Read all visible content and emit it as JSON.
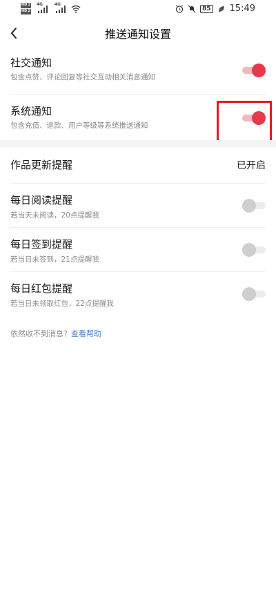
{
  "status_bar": {
    "time": "15:49",
    "battery": "85",
    "network_1": "4G",
    "network_2": "4G",
    "hd_label": "HD"
  },
  "header": {
    "title": "推送通知设置"
  },
  "sections": {
    "social": {
      "title": "社交通知",
      "desc": "包含点赞、评论回复等社交互动相关消息通知",
      "enabled": true
    },
    "system": {
      "title": "系统通知",
      "desc": "包含充值、退款、用户等级等系统推送通知",
      "enabled": true
    },
    "works_update": {
      "title": "作品更新提醒",
      "status": "已开启"
    },
    "daily_read": {
      "title": "每日阅读提醒",
      "desc": "若当天未阅读，20点提醒我",
      "enabled": false
    },
    "daily_checkin": {
      "title": "每日签到提醒",
      "desc": "若当日未签到，21点提醒我",
      "enabled": false
    },
    "daily_redpacket": {
      "title": "每日红包提醒",
      "desc": "若当日未领取红包，22点提醒我",
      "enabled": false
    }
  },
  "help": {
    "prefix": "依然收不到消息？",
    "link": "查看帮助"
  },
  "colors": {
    "accent": "#e8394a",
    "accent_light": "#f3b8bf",
    "link": "#4a7fc1",
    "highlight_box": "#e01b24"
  }
}
